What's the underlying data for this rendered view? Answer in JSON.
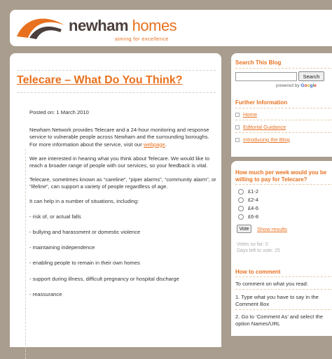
{
  "header": {
    "brand_part1": "newham",
    "brand_part2": " homes",
    "tagline": "aiming for excellence"
  },
  "post": {
    "title": "Telecare – What Do You Think?",
    "posted_on": "Posted on: 1 March 2010",
    "para1": "Newham Network provides Telecare and a 24-hour monitoring and response service to vulnerable people across Newham and the surrounding boroughs. For more information about the service, visit our ",
    "para1_link": "webpage",
    "para1_end": ".",
    "para2": "We are interested in hearing what you think about Telecare. We would like to reach a broader range of people with our services, so your feedback is vital.",
    "para3": "Telecare, sometimes known as “careline”, “piper alarms”, “community alarm”, or “lifeline”, can support a variety of people regardless of age.",
    "para4": "It can help in a number of situations, including:",
    "items": [
      "- risk of, or actual falls",
      "- bullying and harassment or domestic violence",
      "- maintaining independence",
      "- enabling people to remain in their own homes",
      "- support during illness, difficult pregnancy or hospital discharge",
      "- reassurance"
    ]
  },
  "sidebar": {
    "search": {
      "heading": "Search This Blog",
      "button": "Search",
      "input_value": "",
      "powered_by": "powered by ",
      "google": [
        "G",
        "o",
        "o",
        "g",
        "l",
        "e"
      ]
    },
    "further_info": {
      "heading": "Further Information",
      "links": [
        "Home",
        "Editorial Guidance",
        "Introducing the Blog"
      ]
    },
    "poll": {
      "question": "How much per week would you be willing to pay for Telecare?",
      "options": [
        "£1-2",
        "£2-4",
        "£4-6",
        "£6-8"
      ],
      "vote_button": "Vote",
      "show_results": "Show results",
      "votes_so_far": "Votes so far: 0",
      "days_left": "Days left to vote: 25"
    },
    "comment": {
      "heading": "How to comment",
      "intro": "To comment on what you read:",
      "step1": "1. Type what you have to say in the Comment Box",
      "step2": "2. Go to ‘Comment As’ and select the option Names/URL"
    }
  },
  "colors": {
    "accent": "#e8711f",
    "brand_dark": "#4a3f3c",
    "background": "#a89d8e"
  }
}
